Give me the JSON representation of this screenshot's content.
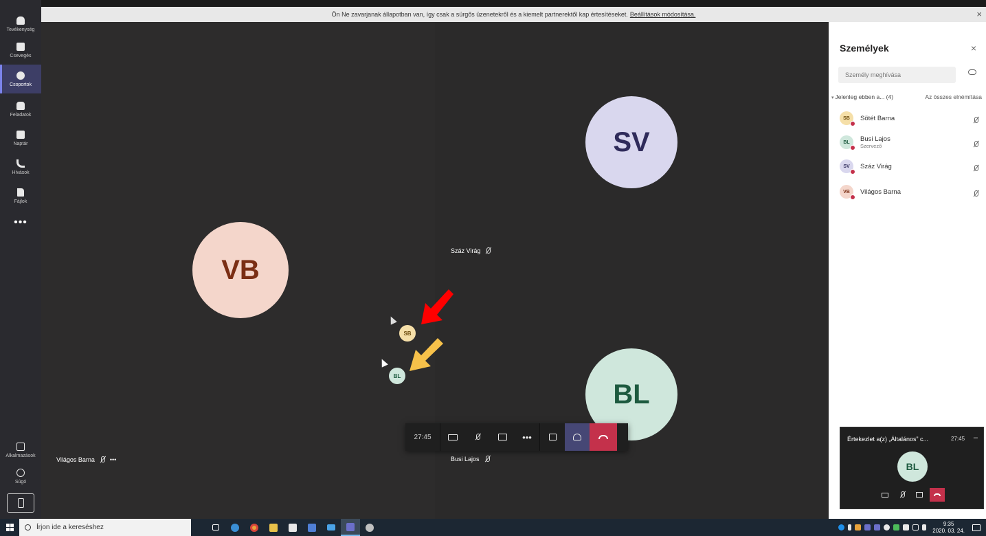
{
  "notification": {
    "text": "Ön Ne zavarjanak állapotban van, így csak a sürgős üzenetekről és a kiemelt partnerektől kap értesítéseket.",
    "link": "Beállítások módosítása."
  },
  "rail": {
    "items": [
      {
        "label": "Tevékenység",
        "icon": "bell-icon"
      },
      {
        "label": "Csevegés",
        "icon": "chat-icon"
      },
      {
        "label": "Csoportok",
        "icon": "teams-icon",
        "active": true
      },
      {
        "label": "Feladatok",
        "icon": "backpack-icon"
      },
      {
        "label": "Naptár",
        "icon": "calendar-icon"
      },
      {
        "label": "Hívások",
        "icon": "phone-icon"
      },
      {
        "label": "Fájlok",
        "icon": "file-icon"
      }
    ],
    "more": "•••",
    "apps_label": "Alkalmazások",
    "help_label": "Súgó"
  },
  "stage": {
    "tiles": [
      {
        "initials": "VB",
        "name": "Világos Barna",
        "bg": "#f4d6cb",
        "fg": "#7a2e14"
      },
      {
        "initials": "SV",
        "name": "Száz Virág",
        "bg": "#d9d7ee",
        "fg": "#2f2b5a"
      },
      {
        "initials": "BL",
        "name": "Busi Lajos",
        "bg": "#cfe7dc",
        "fg": "#1d5a3f"
      }
    ],
    "floating": [
      {
        "initials": "SB",
        "bg": "#f5dfa8",
        "fg": "#6b4b0c"
      },
      {
        "initials": "BL",
        "bg": "#cfe7dc",
        "fg": "#1d5a3f"
      }
    ],
    "arrows": [
      {
        "color": "#ff0000"
      },
      {
        "color": "#f7c14a"
      }
    ],
    "tile_more": "•••"
  },
  "controls": {
    "time": "27:45",
    "more": "•••"
  },
  "panel": {
    "title": "Személyek",
    "invite_placeholder": "Személy meghívása",
    "section_label": "Jelenleg ebben a... (4)",
    "mute_all": "Az összes elnémítása",
    "people": [
      {
        "initials": "SB",
        "name": "Sötét Barna",
        "role": "",
        "bg": "#f5dfa8",
        "fg": "#6b4b0c"
      },
      {
        "initials": "BL",
        "name": "Busi Lajos",
        "role": "Szervező",
        "bg": "#cfe7dc",
        "fg": "#1d5a3f"
      },
      {
        "initials": "SV",
        "name": "Száz Virág",
        "role": "",
        "bg": "#d9d7ee",
        "fg": "#2f2b5a"
      },
      {
        "initials": "VB",
        "name": "Világos Barna",
        "role": "",
        "bg": "#f4d6cb",
        "fg": "#7a2e14"
      }
    ]
  },
  "mini": {
    "title": "Értekezlet a(z) „Általános” c...",
    "time": "27:45",
    "minimize": "–",
    "initials": "BL"
  },
  "taskbar": {
    "search_placeholder": "Írjon ide a kereséshez",
    "time": "9:35",
    "date": "2020. 03. 24."
  }
}
